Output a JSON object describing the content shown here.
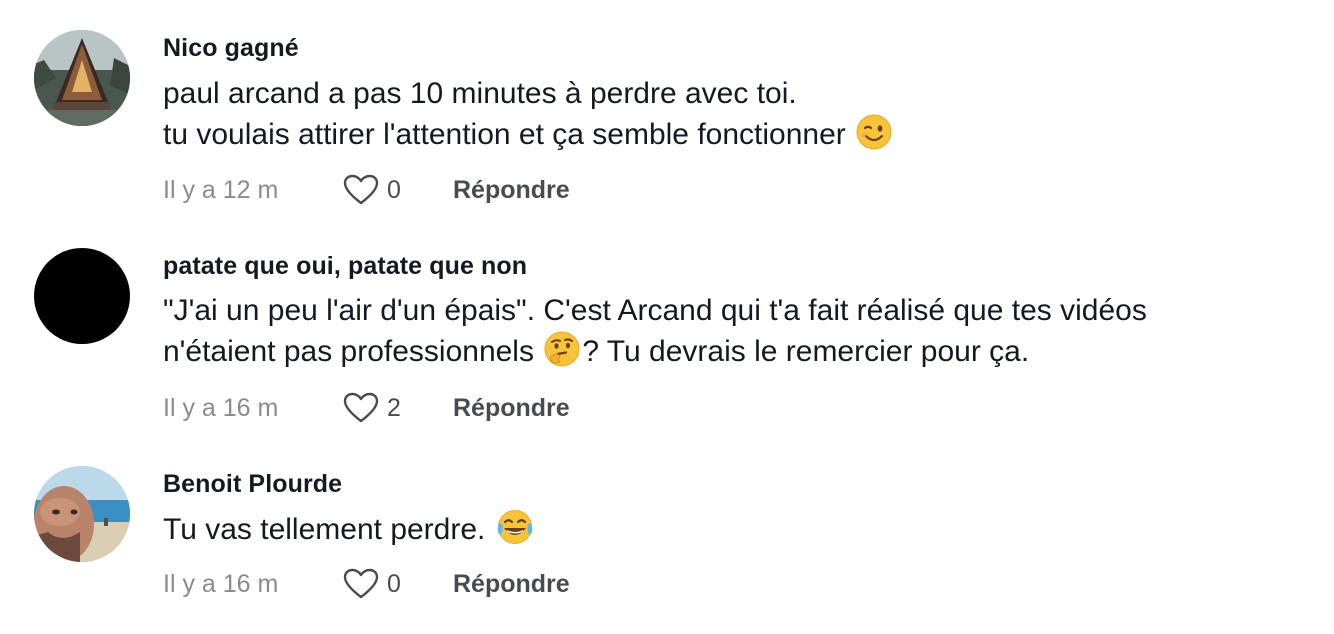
{
  "comments": [
    {
      "username": "Nico gagné",
      "lines": [
        "paul arcand a pas 10 minutes à perdre avec toi.",
        "tu voulais attirer l'attention et ça semble fonctionner"
      ],
      "emoji": "winking-face",
      "time": "Il y a 12 m",
      "likes": "0",
      "reply_label": "Répondre"
    },
    {
      "username": "patate que oui, patate que non",
      "line1": "\"J'ai un peu l'air d'un épais\". C'est Arcand qui t'a fait réalisé que tes vidéos",
      "line2_before": "n'étaient pas professionnels",
      "line2_after": "? Tu devrais le remercier pour ça.",
      "emoji": "thinking-face",
      "time": "Il y a 16 m",
      "likes": "2",
      "reply_label": "Répondre"
    },
    {
      "username": "Benoit Plourde",
      "text": "Tu vas tellement perdre.",
      "emoji": "laughing-tears-face",
      "time": "Il y a 16 m",
      "likes": "0",
      "reply_label": "Répondre"
    }
  ],
  "colors": {
    "username": "#161823",
    "text": "#161823",
    "meta": "#8a8b91",
    "action": "#4a4b52"
  }
}
